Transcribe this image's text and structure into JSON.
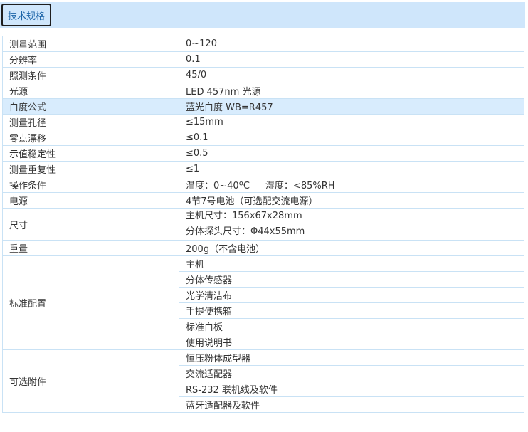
{
  "tab": {
    "label": "技术规格"
  },
  "rows": [
    {
      "key": "测量范围",
      "value": "0~120"
    },
    {
      "key": "分辨率",
      "value": "0.1"
    },
    {
      "key": "照测条件",
      "value": "45/0"
    },
    {
      "key": "光源",
      "value": "LED 457nm 光源"
    },
    {
      "key": "白度公式",
      "value": "蓝光白度 WB=R457"
    },
    {
      "key": "测量孔径",
      "value": "≤15mm"
    },
    {
      "key": "零点漂移",
      "value": "≤0.1"
    },
    {
      "key": "示值稳定性",
      "value": "≤0.5"
    },
    {
      "key": "测量重复性",
      "value": "≤1"
    },
    {
      "key": "操作条件",
      "value1": "温度：0~40ºC",
      "value2": "湿度：<85%RH"
    },
    {
      "key": "电源",
      "value": "4节7号电池（可选配交流电源）"
    },
    {
      "key": "尺寸",
      "line1": "主机尺寸：156x67x28mm",
      "line2": "分体探头尺寸：Φ44x55mm"
    },
    {
      "key": "重量",
      "value": "200g（不含电池）"
    }
  ],
  "standard_config": {
    "key": "标准配置",
    "items": [
      "主机",
      "分体传感器",
      "光学清洁布",
      "手提便携箱",
      "标准白板",
      "使用说明书"
    ]
  },
  "optional_accessories": {
    "key": "可选附件",
    "items": [
      "恒压粉体成型器",
      "交流适配器",
      "RS-232 联机线及软件",
      "蓝牙适配器及软件"
    ]
  }
}
